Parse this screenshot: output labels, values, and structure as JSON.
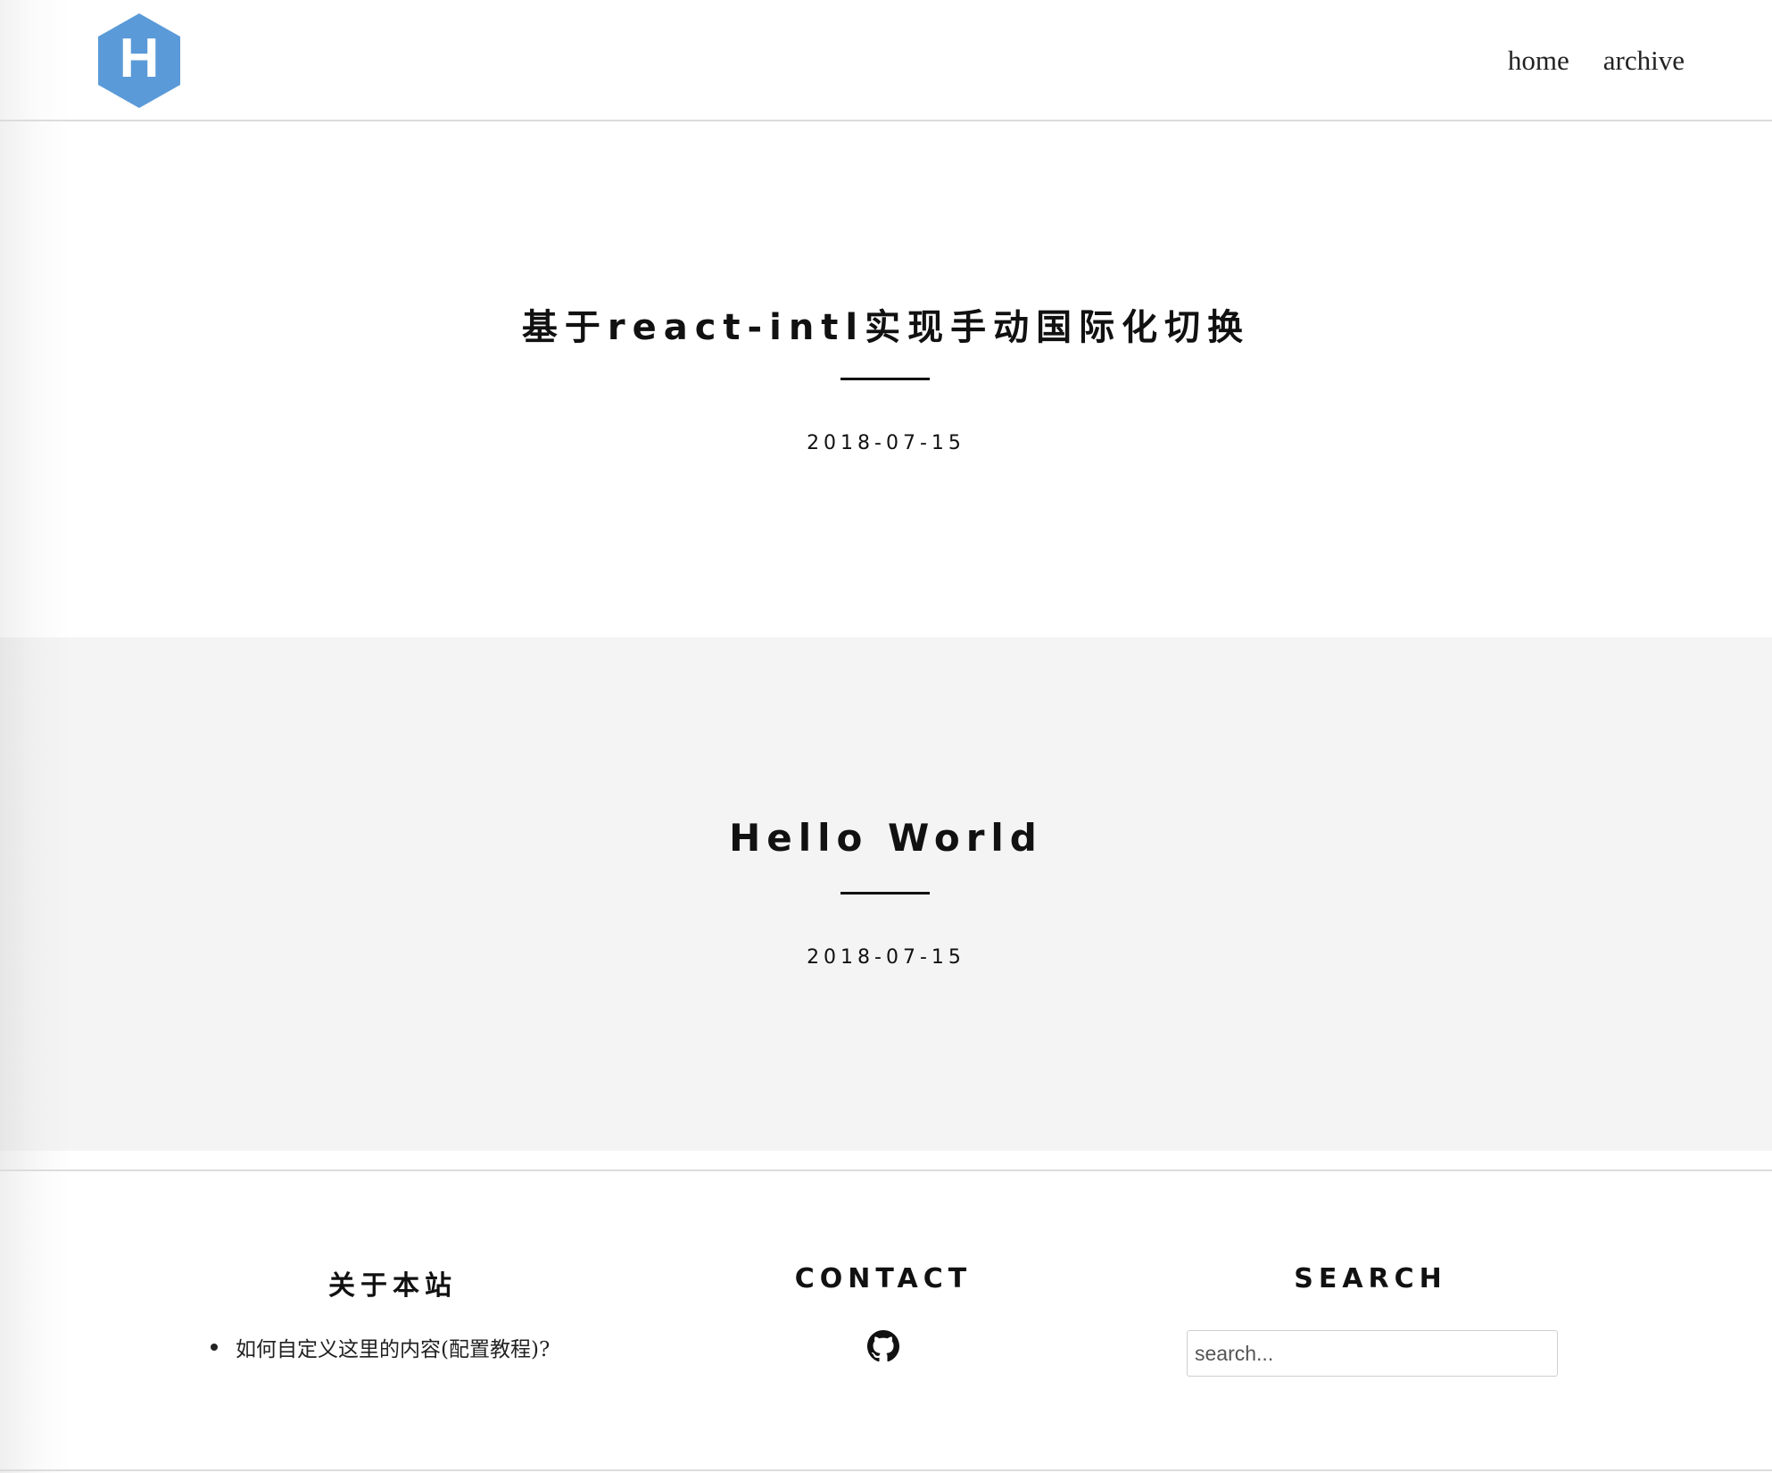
{
  "header": {
    "logo_letter": "H",
    "nav": [
      {
        "label": "home"
      },
      {
        "label": "archive"
      }
    ]
  },
  "posts": [
    {
      "title": "基于react-intl实现手动国际化切换",
      "date": "2018-07-15"
    },
    {
      "title": "Hello World",
      "date": "2018-07-15"
    }
  ],
  "footer": {
    "about": {
      "heading": "关于本站",
      "items": [
        {
          "label": "如何自定义这里的内容(配置教程)?"
        }
      ]
    },
    "contact": {
      "heading": "CONTACT",
      "icons": [
        "github-icon"
      ]
    },
    "search": {
      "heading": "SEARCH",
      "placeholder": "search..."
    }
  },
  "colors": {
    "logo_blue": "#5a9ad8",
    "text": "#111111",
    "alt_section_bg": "#f4f4f4"
  }
}
